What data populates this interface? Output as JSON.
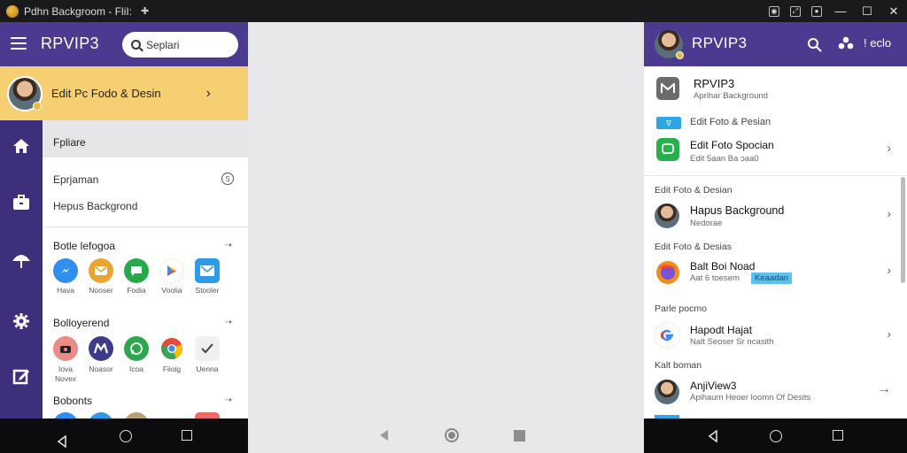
{
  "window": {
    "title": "Pdhn Backgroom - FliI:",
    "controls": [
      "minimize",
      "maximize",
      "close"
    ]
  },
  "left_app": {
    "brand": "RPVIP3",
    "search_placeholder": "Seplari",
    "header_icons": [
      "bank-icon",
      "puzzle-icon",
      "flower-icon",
      "more-icon"
    ],
    "profile_row_label": "Edit Pc Fodo & Desin",
    "rail_icons": [
      "home-icon",
      "briefcase-icon",
      "umbrella-icon",
      "gear-icon",
      "edit-icon"
    ],
    "section_header": "Fpliare",
    "card_rows": [
      "Eprjaman",
      "Hepus Backgrond"
    ],
    "groups": [
      {
        "title": "Botle lefogoa",
        "apps": [
          {
            "label": "Hava",
            "icon": "messenger-icon",
            "color": "#2f8ef0"
          },
          {
            "label": "Nooser",
            "icon": "mail-icon",
            "color": "#eba332"
          },
          {
            "label": "Fodia",
            "icon": "chat-icon",
            "color": "#27a84a"
          },
          {
            "label": "Voolia",
            "icon": "play-store-icon",
            "color": "#ffffff"
          },
          {
            "label": "Stooler",
            "icon": "envelope-icon",
            "color": "#2d9be8"
          }
        ]
      },
      {
        "title": "Bolloyerend",
        "apps": [
          {
            "label": "Iova Novex",
            "icon": "camera-icon",
            "color": "#ec8a86"
          },
          {
            "label": "Noasor",
            "icon": "m-logo-icon",
            "color": "#3e3a8c"
          },
          {
            "label": "Icoa",
            "icon": "whatsapp-icon",
            "color": "#2ba84e"
          },
          {
            "label": "Fiioig",
            "icon": "chrome-icon",
            "color": "#e64a3b"
          },
          {
            "label": "Uenna",
            "icon": "check-icon",
            "color": "#f0f0f0"
          }
        ]
      },
      {
        "title": "Bobonts",
        "apps": []
      }
    ]
  },
  "right_app": {
    "brand": "RPVIP3",
    "header_right_text": "ǃ eclo",
    "items_top": [
      {
        "title": "RPVIP3",
        "sub": "Aprihar Background",
        "icon": "gmail-icon"
      },
      {
        "title": "Edit Foto & Pesian",
        "sub": "",
        "icon": "tag-icon"
      },
      {
        "title": "Edit Foto Spocian",
        "sub": "Edit 5aan Ba ɔaa0",
        "icon": "message-icon"
      }
    ],
    "sections": [
      {
        "header": "Edit Foto & Desian",
        "item": {
          "title": "Hapus Background",
          "sub": "Nedorae",
          "icon": "portrait-icon"
        }
      },
      {
        "header": "Edit Foto & Desias",
        "item": {
          "title": "Balt Boi Noad",
          "sub": "Aat  6  toesem",
          "badge": "Keaadan",
          "icon": "firefox-icon"
        }
      },
      {
        "header": "Parle pocmo",
        "item": {
          "title": "Hapodt Hajat",
          "sub": "Nalt Seoser Sr ncasith",
          "icon": "google-icon"
        }
      },
      {
        "header": "Kalt boman",
        "item": {
          "title": "AnjiView3",
          "sub": "Apihaum Heoer loomn Of Desits",
          "icon": "person-icon"
        }
      }
    ]
  },
  "navbar": {
    "buttons": [
      "back",
      "home",
      "recents"
    ]
  },
  "colors": {
    "header_purple": "#4b3a8f",
    "rail_purple": "#3e2f7c",
    "highlight_yellow": "#f5cf72",
    "badge_blue": "#5ec0ee"
  }
}
